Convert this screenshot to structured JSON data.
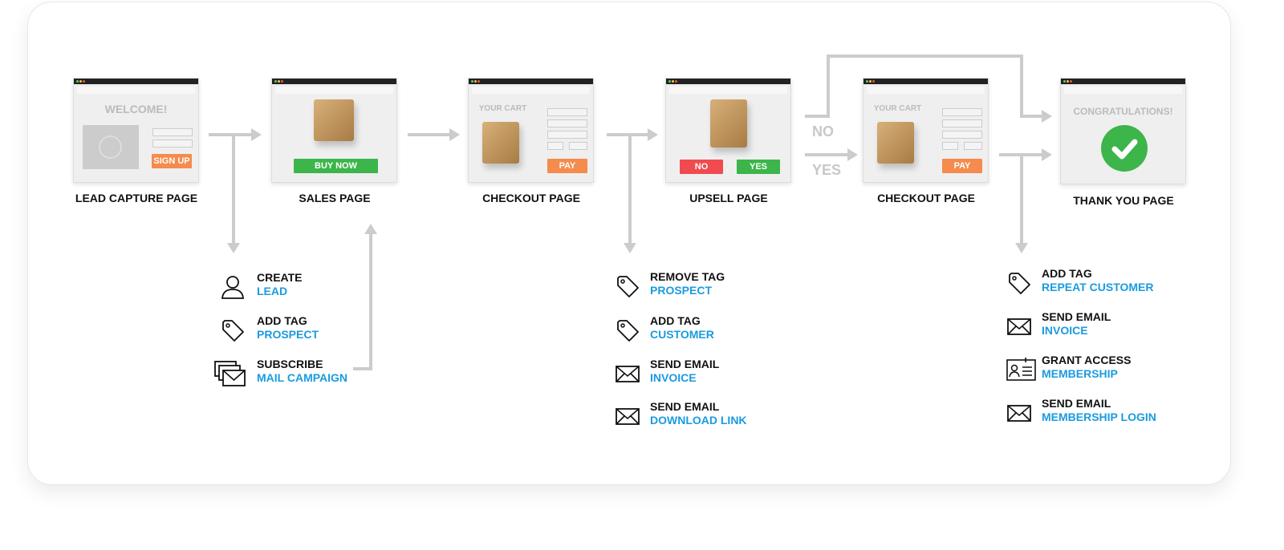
{
  "pages": [
    {
      "label": "LEAD CAPTURE PAGE",
      "title": "WELCOME!",
      "button": "SIGN UP"
    },
    {
      "label": "SALES PAGE",
      "button": "BUY NOW"
    },
    {
      "label": "CHECKOUT PAGE",
      "title": "YOUR CART",
      "button": "PAY"
    },
    {
      "label": "UPSELL PAGE",
      "no_button": "NO",
      "yes_button": "YES"
    },
    {
      "label": "CHECKOUT PAGE",
      "title": "YOUR CART",
      "button": "PAY"
    },
    {
      "label": "THANK YOU PAGE",
      "title": "CONGRATULATIONS!"
    }
  ],
  "branches": {
    "no": "NO",
    "yes": "YES"
  },
  "groups": [
    [
      {
        "icon": "user-icon",
        "action": "CREATE",
        "value": "LEAD"
      },
      {
        "icon": "tag-icon",
        "action": "ADD TAG",
        "value": "PROSPECT"
      },
      {
        "icon": "mail-stack-icon",
        "action": "SUBSCRIBE",
        "value": "MAIL CAMPAIGN"
      }
    ],
    [
      {
        "icon": "tag-icon",
        "action": "REMOVE TAG",
        "value": "PROSPECT"
      },
      {
        "icon": "tag-icon",
        "action": "ADD TAG",
        "value": "CUSTOMER"
      },
      {
        "icon": "mail-icon",
        "action": "SEND EMAIL",
        "value": "INVOICE"
      },
      {
        "icon": "mail-icon",
        "action": "SEND EMAIL",
        "value": "DOWNLOAD LINK"
      }
    ],
    [
      {
        "icon": "tag-icon",
        "action": "ADD TAG",
        "value": "REPEAT CUSTOMER"
      },
      {
        "icon": "mail-icon",
        "action": "SEND EMAIL",
        "value": "INVOICE"
      },
      {
        "icon": "id-card-icon",
        "action": "GRANT ACCESS",
        "value": "MEMBERSHIP"
      },
      {
        "icon": "mail-icon",
        "action": "SEND EMAIL",
        "value": "MEMBERSHIP LOGIN"
      }
    ]
  ],
  "colors": {
    "accent": "#1a9be0",
    "green": "#3cb54a",
    "orange": "#f58b4c",
    "red": "#f04b4f",
    "arrow": "#cccccc"
  }
}
